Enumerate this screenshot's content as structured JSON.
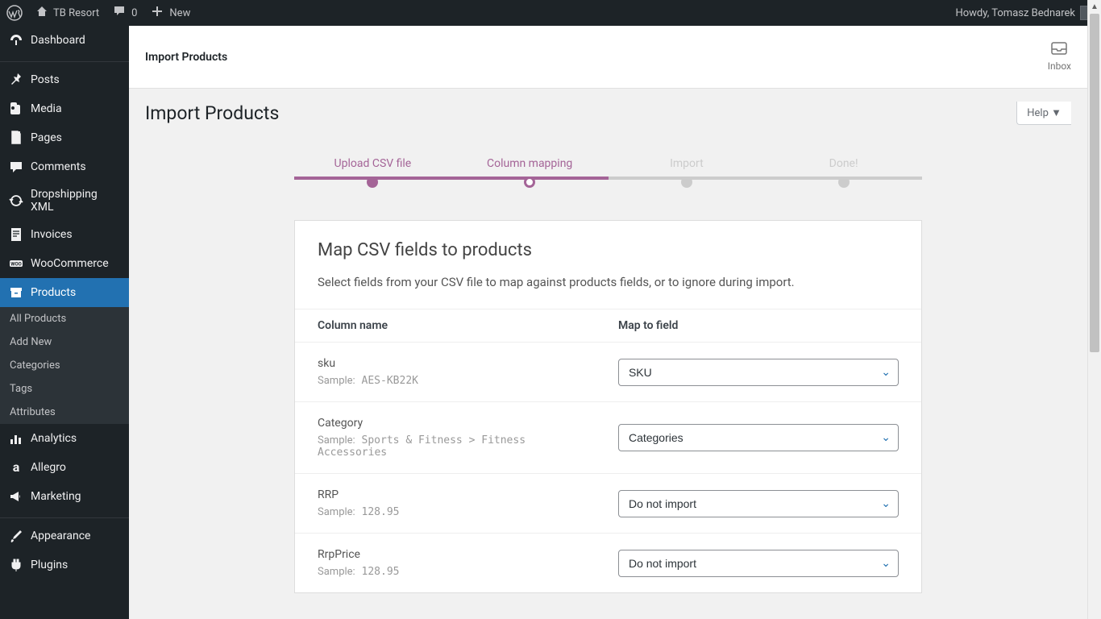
{
  "adminbar": {
    "site_name": "TB Resort",
    "comments_count": "0",
    "new_label": "New",
    "greeting": "Howdy, Tomasz Bednarek"
  },
  "sidebar": {
    "items": [
      {
        "label": "Dashboard",
        "icon": "dashboard"
      },
      {
        "label": "Posts",
        "icon": "pin"
      },
      {
        "label": "Media",
        "icon": "media"
      },
      {
        "label": "Pages",
        "icon": "page"
      },
      {
        "label": "Comments",
        "icon": "comment"
      },
      {
        "label": "Dropshipping XML",
        "icon": "refresh"
      },
      {
        "label": "Invoices",
        "icon": "invoice"
      },
      {
        "label": "WooCommerce",
        "icon": "woo"
      },
      {
        "label": "Products",
        "icon": "archive",
        "current": true
      },
      {
        "label": "Analytics",
        "icon": "chart"
      },
      {
        "label": "Allegro",
        "icon": "allegro"
      },
      {
        "label": "Marketing",
        "icon": "megaphone"
      },
      {
        "label": "Appearance",
        "icon": "brush"
      },
      {
        "label": "Plugins",
        "icon": "plugin"
      }
    ],
    "submenu": [
      "All Products",
      "Add New",
      "Categories",
      "Tags",
      "Attributes"
    ]
  },
  "header": {
    "breadcrumb": "Import Products",
    "inbox_label": "Inbox",
    "page_title": "Import Products",
    "help_label": "Help"
  },
  "wizard": {
    "steps": [
      {
        "label": "Upload CSV file",
        "state": "done"
      },
      {
        "label": "Column mapping",
        "state": "active"
      },
      {
        "label": "Import",
        "state": "pending"
      },
      {
        "label": "Done!",
        "state": "pending"
      }
    ]
  },
  "card": {
    "title": "Map CSV fields to products",
    "description": "Select fields from your CSV file to map against products fields, or to ignore during import.",
    "th_column": "Column name",
    "th_field": "Map to field",
    "sample_prefix": "Sample:",
    "rows": [
      {
        "name": "sku",
        "sample": "AES-KB22K",
        "selected": "SKU"
      },
      {
        "name": "Category",
        "sample": "Sports & Fitness > Fitness Accessories",
        "selected": "Categories"
      },
      {
        "name": "RRP",
        "sample": "128.95",
        "selected": "Do not import"
      },
      {
        "name": "RrpPrice",
        "sample": "128.95",
        "selected": "Do not import"
      }
    ]
  }
}
